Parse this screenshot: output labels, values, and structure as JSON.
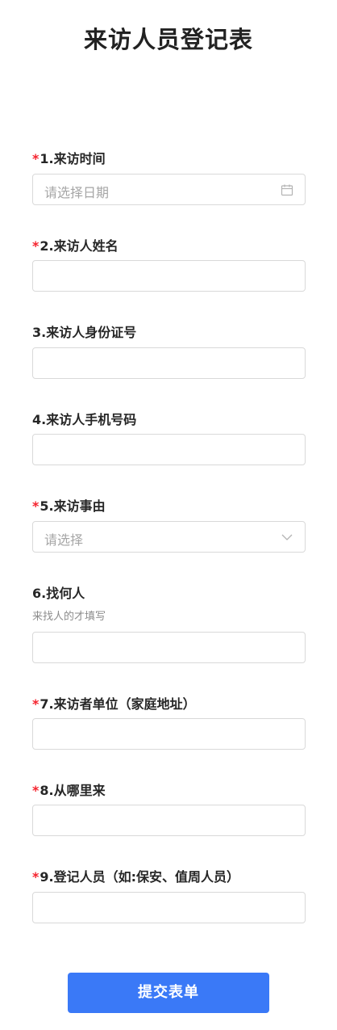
{
  "page": {
    "title": "来访人员登记表"
  },
  "form": {
    "required_mark": "*",
    "fields": [
      {
        "label": "1.来访时间",
        "required": true,
        "type": "date",
        "placeholder": "请选择日期",
        "value": ""
      },
      {
        "label": "2.来访人姓名",
        "required": true,
        "type": "text",
        "placeholder": "",
        "value": ""
      },
      {
        "label": "3.来访人身份证号",
        "required": false,
        "type": "text",
        "placeholder": "",
        "value": ""
      },
      {
        "label": "4.来访人手机号码",
        "required": false,
        "type": "text",
        "placeholder": "",
        "value": ""
      },
      {
        "label": "5.来访事由",
        "required": true,
        "type": "select",
        "placeholder": "请选择",
        "value": ""
      },
      {
        "label": "6.找何人",
        "required": false,
        "type": "text",
        "hint": "来找人的才填写",
        "placeholder": "",
        "value": ""
      },
      {
        "label": "7.来访者单位（家庭地址）",
        "required": true,
        "type": "text",
        "placeholder": "",
        "value": ""
      },
      {
        "label": "8.从哪里来",
        "required": true,
        "type": "text",
        "placeholder": "",
        "value": ""
      },
      {
        "label": "9.登记人员（如:保安、值周人员）",
        "required": true,
        "type": "text",
        "placeholder": "",
        "value": ""
      }
    ],
    "submit_label": "提交表单"
  },
  "icons": {
    "date": "calendar-icon",
    "select": "chevron-down-icon"
  },
  "colors": {
    "required": "#f5222d",
    "submit_bg": "#3a79f7",
    "border": "#d9d9d9",
    "placeholder": "#a6a6a6"
  }
}
